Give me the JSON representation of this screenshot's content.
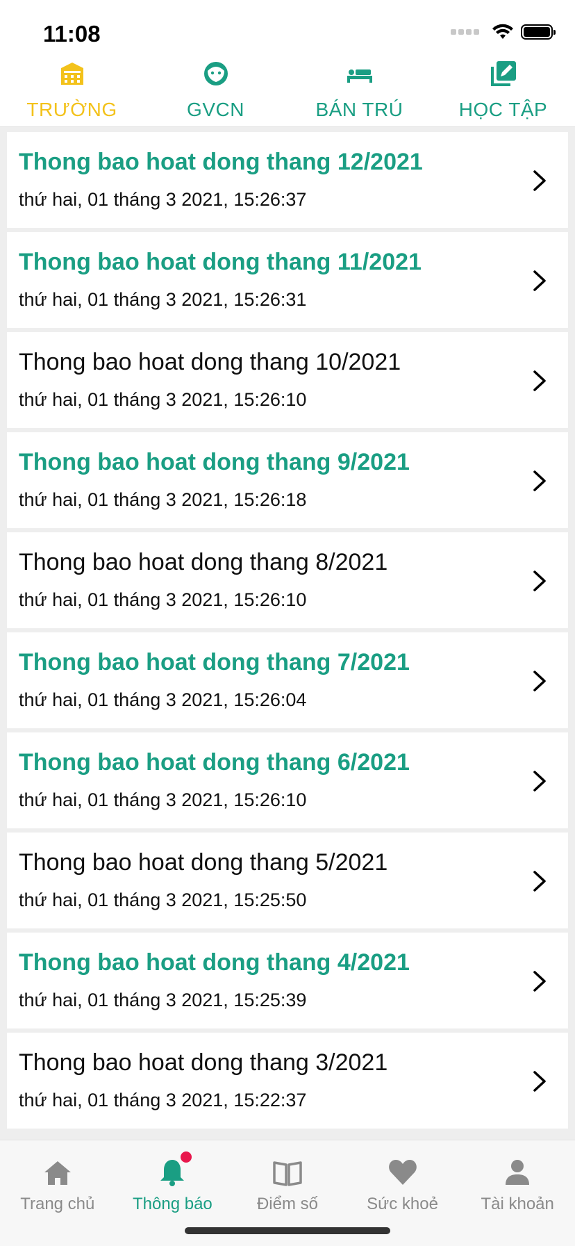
{
  "status_bar": {
    "time": "11:08"
  },
  "colors": {
    "accent": "#1a9e83",
    "active_top_tab": "#f3c21b",
    "badge": "#e8174c",
    "inactive": "#8a8a8a"
  },
  "top_tabs": [
    {
      "label": "TRƯỜNG",
      "icon": "school-icon",
      "active": true
    },
    {
      "label": "GVCN",
      "icon": "teacher-face-icon",
      "active": false
    },
    {
      "label": "BÁN TRÚ",
      "icon": "bed-icon",
      "active": false
    },
    {
      "label": "HỌC TẬP",
      "icon": "edit-notes-icon",
      "active": false
    }
  ],
  "notifications": [
    {
      "title": "Thong bao hoat dong thang 12/2021",
      "time": "thứ hai, 01 tháng 3 2021, 15:26:37",
      "unread": true
    },
    {
      "title": "Thong bao hoat dong thang 11/2021",
      "time": "thứ hai, 01 tháng 3 2021, 15:26:31",
      "unread": true
    },
    {
      "title": "Thong bao hoat dong thang 10/2021",
      "time": "thứ hai, 01 tháng 3 2021, 15:26:10",
      "unread": false
    },
    {
      "title": "Thong bao hoat dong thang 9/2021",
      "time": "thứ hai, 01 tháng 3 2021, 15:26:18",
      "unread": true
    },
    {
      "title": "Thong bao hoat dong thang 8/2021",
      "time": "thứ hai, 01 tháng 3 2021, 15:26:10",
      "unread": false
    },
    {
      "title": "Thong bao hoat dong thang 7/2021",
      "time": "thứ hai, 01 tháng 3 2021, 15:26:04",
      "unread": true
    },
    {
      "title": "Thong bao hoat dong thang 6/2021",
      "time": "thứ hai, 01 tháng 3 2021, 15:26:10",
      "unread": true
    },
    {
      "title": "Thong bao hoat dong thang 5/2021",
      "time": "thứ hai, 01 tháng 3 2021, 15:25:50",
      "unread": false
    },
    {
      "title": "Thong bao hoat dong thang 4/2021",
      "time": "thứ hai, 01 tháng 3 2021, 15:25:39",
      "unread": true
    },
    {
      "title": "Thong bao hoat dong thang 3/2021",
      "time": "thứ hai, 01 tháng 3 2021, 15:22:37",
      "unread": false
    }
  ],
  "bottom_nav": [
    {
      "label": "Trang chủ",
      "icon": "home-icon",
      "active": false
    },
    {
      "label": "Thông báo",
      "icon": "bell-icon",
      "active": true,
      "badge": true
    },
    {
      "label": "Điểm số",
      "icon": "book-icon",
      "active": false
    },
    {
      "label": "Sức khoẻ",
      "icon": "heart-icon",
      "active": false
    },
    {
      "label": "Tài khoản",
      "icon": "person-icon",
      "active": false
    }
  ]
}
